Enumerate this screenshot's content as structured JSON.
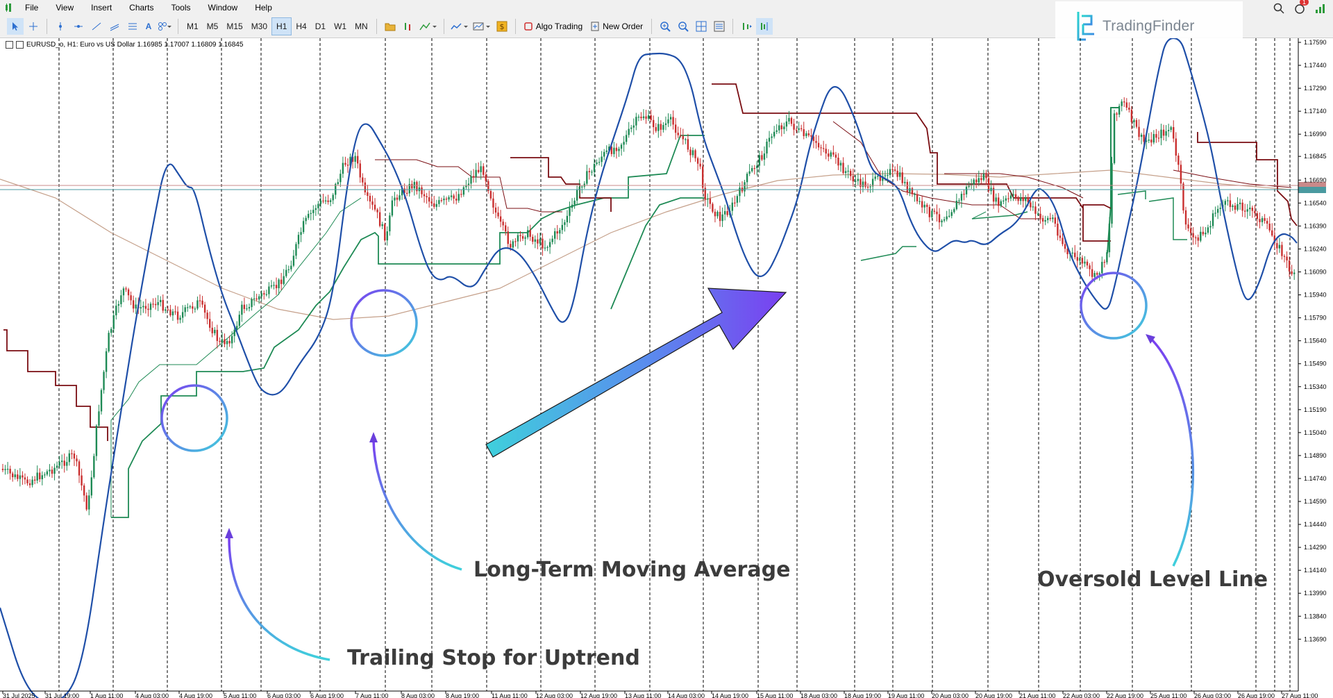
{
  "menu": [
    "File",
    "View",
    "Insert",
    "Charts",
    "Tools",
    "Window",
    "Help"
  ],
  "timeframes": [
    "M1",
    "M5",
    "M15",
    "M30",
    "H1",
    "H4",
    "D1",
    "W1",
    "MN"
  ],
  "active_timeframe": "H1",
  "toolbar": {
    "algo_trading": "Algo Trading",
    "new_order": "New Order"
  },
  "chart_header": "EURUSD_o, H1:  Euro vs US Dollar  1.16985 1.17007 1.16809 1.16845",
  "logo": "TradingFinder",
  "notification_count": "1",
  "price_labels": [
    "1.17590",
    "1.17440",
    "1.17290",
    "1.17140",
    "1.16990",
    "1.16845",
    "1.16690",
    "1.16540",
    "1.16390",
    "1.16240",
    "1.16090",
    "1.15940",
    "1.15790",
    "1.15640",
    "1.15490",
    "1.15340",
    "1.15190",
    "1.15040",
    "1.14890",
    "1.14740",
    "1.14590",
    "1.14440",
    "1.14290",
    "1.14140",
    "1.13990",
    "1.13840",
    "1.13690"
  ],
  "time_labels": [
    "31 Jul 2025",
    "31 Jul 19:00",
    "1 Aug 11:00",
    "4 Aug 03:00",
    "4 Aug 19:00",
    "5 Aug 11:00",
    "6 Aug 03:00",
    "6 Aug 19:00",
    "7 Aug 11:00",
    "8 Aug 03:00",
    "8 Aug 19:00",
    "11 Aug 11:00",
    "12 Aug 03:00",
    "12 Aug 19:00",
    "13 Aug 11:00",
    "14 Aug 03:00",
    "14 Aug 19:00",
    "15 Aug 11:00",
    "18 Aug 03:00",
    "18 Aug 19:00",
    "19 Aug 11:00",
    "20 Aug 03:00",
    "20 Aug 19:00",
    "21 Aug 11:00",
    "22 Aug 03:00",
    "22 Aug 19:00",
    "25 Aug 11:00",
    "26 Aug 03:00",
    "26 Aug 19:00",
    "27 Aug 11:00"
  ],
  "annotations": {
    "trailing_stop": "Trailing Stop for Uptrend",
    "long_term_ma": "Long-Term Moving Average",
    "oversold": "Oversold Level Line"
  },
  "colors": {
    "oscillator": "#1f4fa8",
    "stop_up": "#1e8a55",
    "stop_down": "#7a0d12",
    "ma_long": "#c5a08a",
    "bull_candle": "#1e8a55",
    "bear_candle": "#c92e2e",
    "grid": "#000000",
    "circle": "#6a3fdc",
    "arrow_start": "#3fd0dc",
    "arrow_end": "#7a3ff0"
  }
}
